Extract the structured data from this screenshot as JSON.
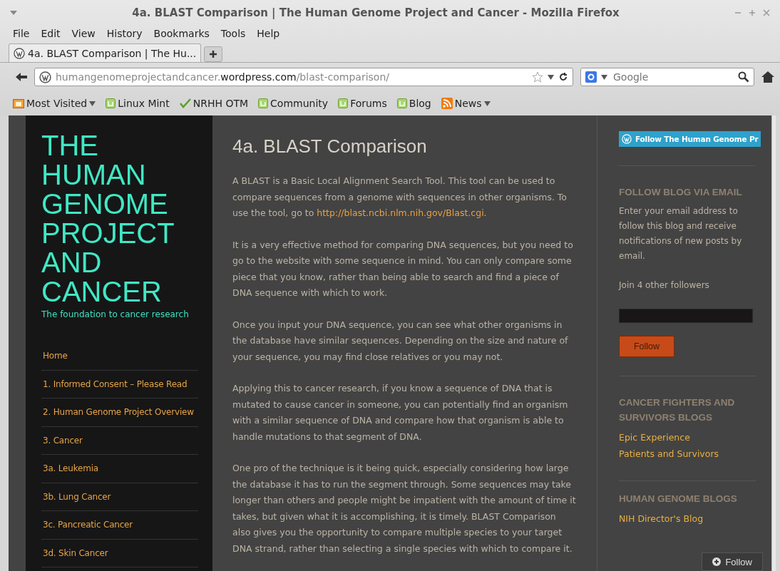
{
  "window": {
    "title": "4a. BLAST Comparison | The Human Genome Project and Cancer - Mozilla Firefox"
  },
  "menu": [
    "File",
    "Edit",
    "View",
    "History",
    "Bookmarks",
    "Tools",
    "Help"
  ],
  "tabs": [
    {
      "label": "4a. BLAST Comparison | The Hu...",
      "selected": true
    }
  ],
  "address": {
    "host": "humangenomeprojectandcancer.",
    "domain": "wordpress.com",
    "path": "/blast-comparison/"
  },
  "search": {
    "placeholder": "Google"
  },
  "bookmarks": [
    {
      "label": "Most Visited",
      "kind": "folder",
      "menu": true
    },
    {
      "label": "Linux Mint",
      "kind": "mint",
      "menu": false
    },
    {
      "label": "NRHH OTM",
      "kind": "check",
      "menu": false
    },
    {
      "label": "Community",
      "kind": "mint",
      "menu": false
    },
    {
      "label": "Forums",
      "kind": "mint",
      "menu": false
    },
    {
      "label": "Blog",
      "kind": "mint",
      "menu": false
    },
    {
      "label": "News",
      "kind": "feed",
      "menu": true
    }
  ],
  "site": {
    "title_lines": [
      "THE",
      "HUMAN",
      "GENOME",
      "PROJECT",
      "AND",
      "CANCER"
    ],
    "tagline": "The foundation to cancer research"
  },
  "nav": [
    "Home",
    "1. Informed Consent – Please Read",
    "2. Human Genome Project Overview",
    "3. Cancer",
    "3a. Leukemia",
    "3b. Lung Cancer",
    "3c. Pancreatic Cancer",
    "3d. Skin Cancer"
  ],
  "post": {
    "title": "4a. BLAST Comparison",
    "paragraphs": [
      {
        "text": "A BLAST is a Basic Local Alignment Search Tool. This tool can be used to compare sequences from a genome with sequences in other organisms. To use the tool, go to ",
        "link": "http://blast.ncbi.nlm.nih.gov/Blast.cgi",
        "after": "."
      },
      {
        "text": "It is a very effective method for comparing DNA sequences, but you need to go to the website with some sequence in mind. You can only compare some piece that you know, rather than being able to search and find a piece of DNA sequence with which to work."
      },
      {
        "text": "Once you input your DNA sequence, you can see what other organisms in the database have similar sequences. Depending on the size and nature of your sequence, you may find close relatives or you may not."
      },
      {
        "text": "Applying this to cancer research, if you know a sequence of DNA that is mutated to cause cancer in someone, you can potentially find an organism with a similar sequence of DNA and compare how that organism is able to handle mutations to that segment of DNA."
      },
      {
        "text": "One pro of the technique is it being quick, especially considering how large the database it has to run the segment through. Some sequences may take longer than others and people might be impatient with the amount of time it takes, but given what it is accomplishing, it is timely. BLAST Comparison also gives you the opportunity to compare multiple species to your target DNA strand, rather than selecting a single species with which to compare it."
      }
    ]
  },
  "widgets": {
    "follow_badge": "Follow The Human Genome Pr",
    "email": {
      "heading": "FOLLOW BLOG VIA EMAIL",
      "text": "Enter your email address to follow this blog and receive notifications of new posts by email.",
      "followers": "Join 4 other followers",
      "button": "Follow"
    },
    "blogs": {
      "heading": "CANCER FIGHTERS AND SURVIVORS BLOGS",
      "links": [
        "Epic Experience",
        "Patients and Survivors"
      ]
    },
    "genome": {
      "heading": "HUMAN GENOME BLOGS",
      "links": [
        "NIH Director's Blog"
      ]
    }
  },
  "follow_bar": {
    "label": "Follow"
  }
}
